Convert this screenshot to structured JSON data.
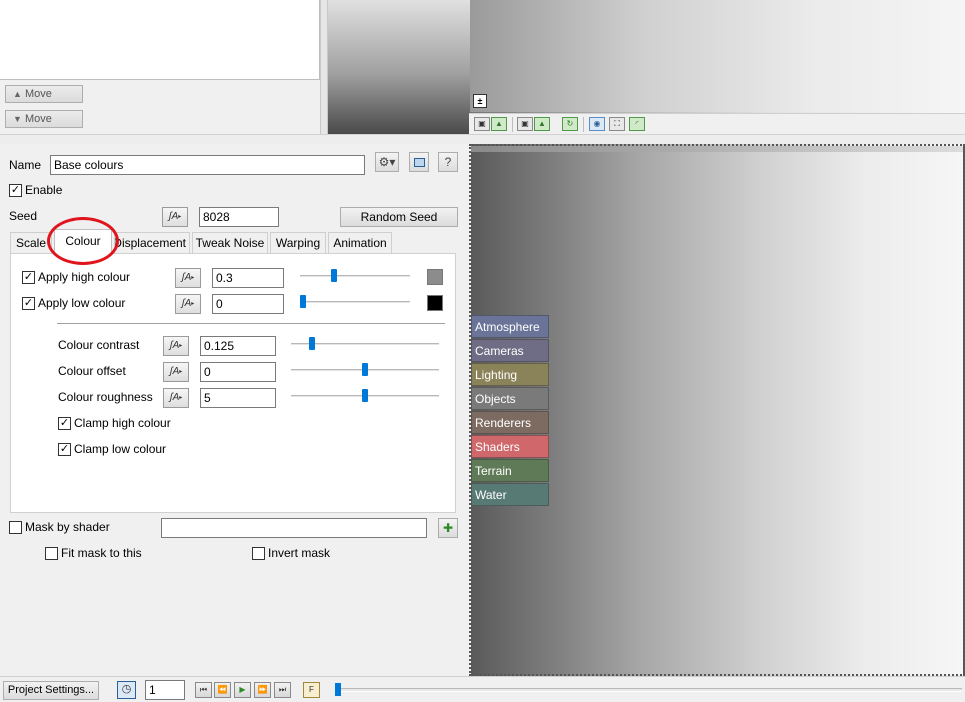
{
  "move_buttons": {
    "up_label": "Move",
    "down_label": "Move"
  },
  "name_row": {
    "label": "Name",
    "value": "Base colours",
    "help_label": "?"
  },
  "enable": {
    "label": "Enable",
    "checked": true
  },
  "seed": {
    "label": "Seed",
    "value": "8028",
    "random_button_label": "Random Seed"
  },
  "tabs": [
    {
      "label": "Scale",
      "active": false
    },
    {
      "label": "Colour",
      "active": true
    },
    {
      "label": "Displacement",
      "active": false
    },
    {
      "label": "Tweak Noise",
      "active": false
    },
    {
      "label": "Warping",
      "active": false
    },
    {
      "label": "Animation",
      "active": false
    }
  ],
  "colour_tab": {
    "apply_high": {
      "label": "Apply high colour",
      "checked": true,
      "value": "0.3",
      "slider_fraction": 0.3,
      "swatch_color": "#8c8c8c"
    },
    "apply_low": {
      "label": "Apply low colour",
      "checked": true,
      "value": "0",
      "slider_fraction": 0.0,
      "swatch_color": "#000000"
    },
    "contrast": {
      "label": "Colour contrast",
      "value": "0.125",
      "slider_fraction": 0.125
    },
    "offset": {
      "label": "Colour offset",
      "value": "0",
      "slider_fraction": 0.5
    },
    "roughness": {
      "label": "Colour roughness",
      "value": "5",
      "slider_fraction": 0.5
    },
    "clamp_high": {
      "label": "Clamp high colour",
      "checked": true
    },
    "clamp_low": {
      "label": "Clamp low colour",
      "checked": true
    }
  },
  "mask": {
    "label": "Mask by shader",
    "checked": false,
    "value": "",
    "fit_mask_label": "Fit mask to this",
    "fit_mask_checked": false,
    "invert_mask_label": "Invert mask",
    "invert_mask_checked": false
  },
  "node_list": [
    {
      "label": "Atmosphere",
      "color": "#6a7398"
    },
    {
      "label": "Cameras",
      "color": "#6f6d85"
    },
    {
      "label": "Lighting",
      "color": "#8a8258"
    },
    {
      "label": "Objects",
      "color": "#7a7a7a"
    },
    {
      "label": "Renderers",
      "color": "#7d6b62"
    },
    {
      "label": "Shaders",
      "color": "#d0676a"
    },
    {
      "label": "Terrain",
      "color": "#5f7a57"
    },
    {
      "label": "Water",
      "color": "#587a74"
    }
  ],
  "bottom_bar": {
    "project_settings_label": "Project Settings...",
    "frame_value": "1"
  },
  "accent_color": "#0078d7",
  "annotation_color": "#e0141c"
}
